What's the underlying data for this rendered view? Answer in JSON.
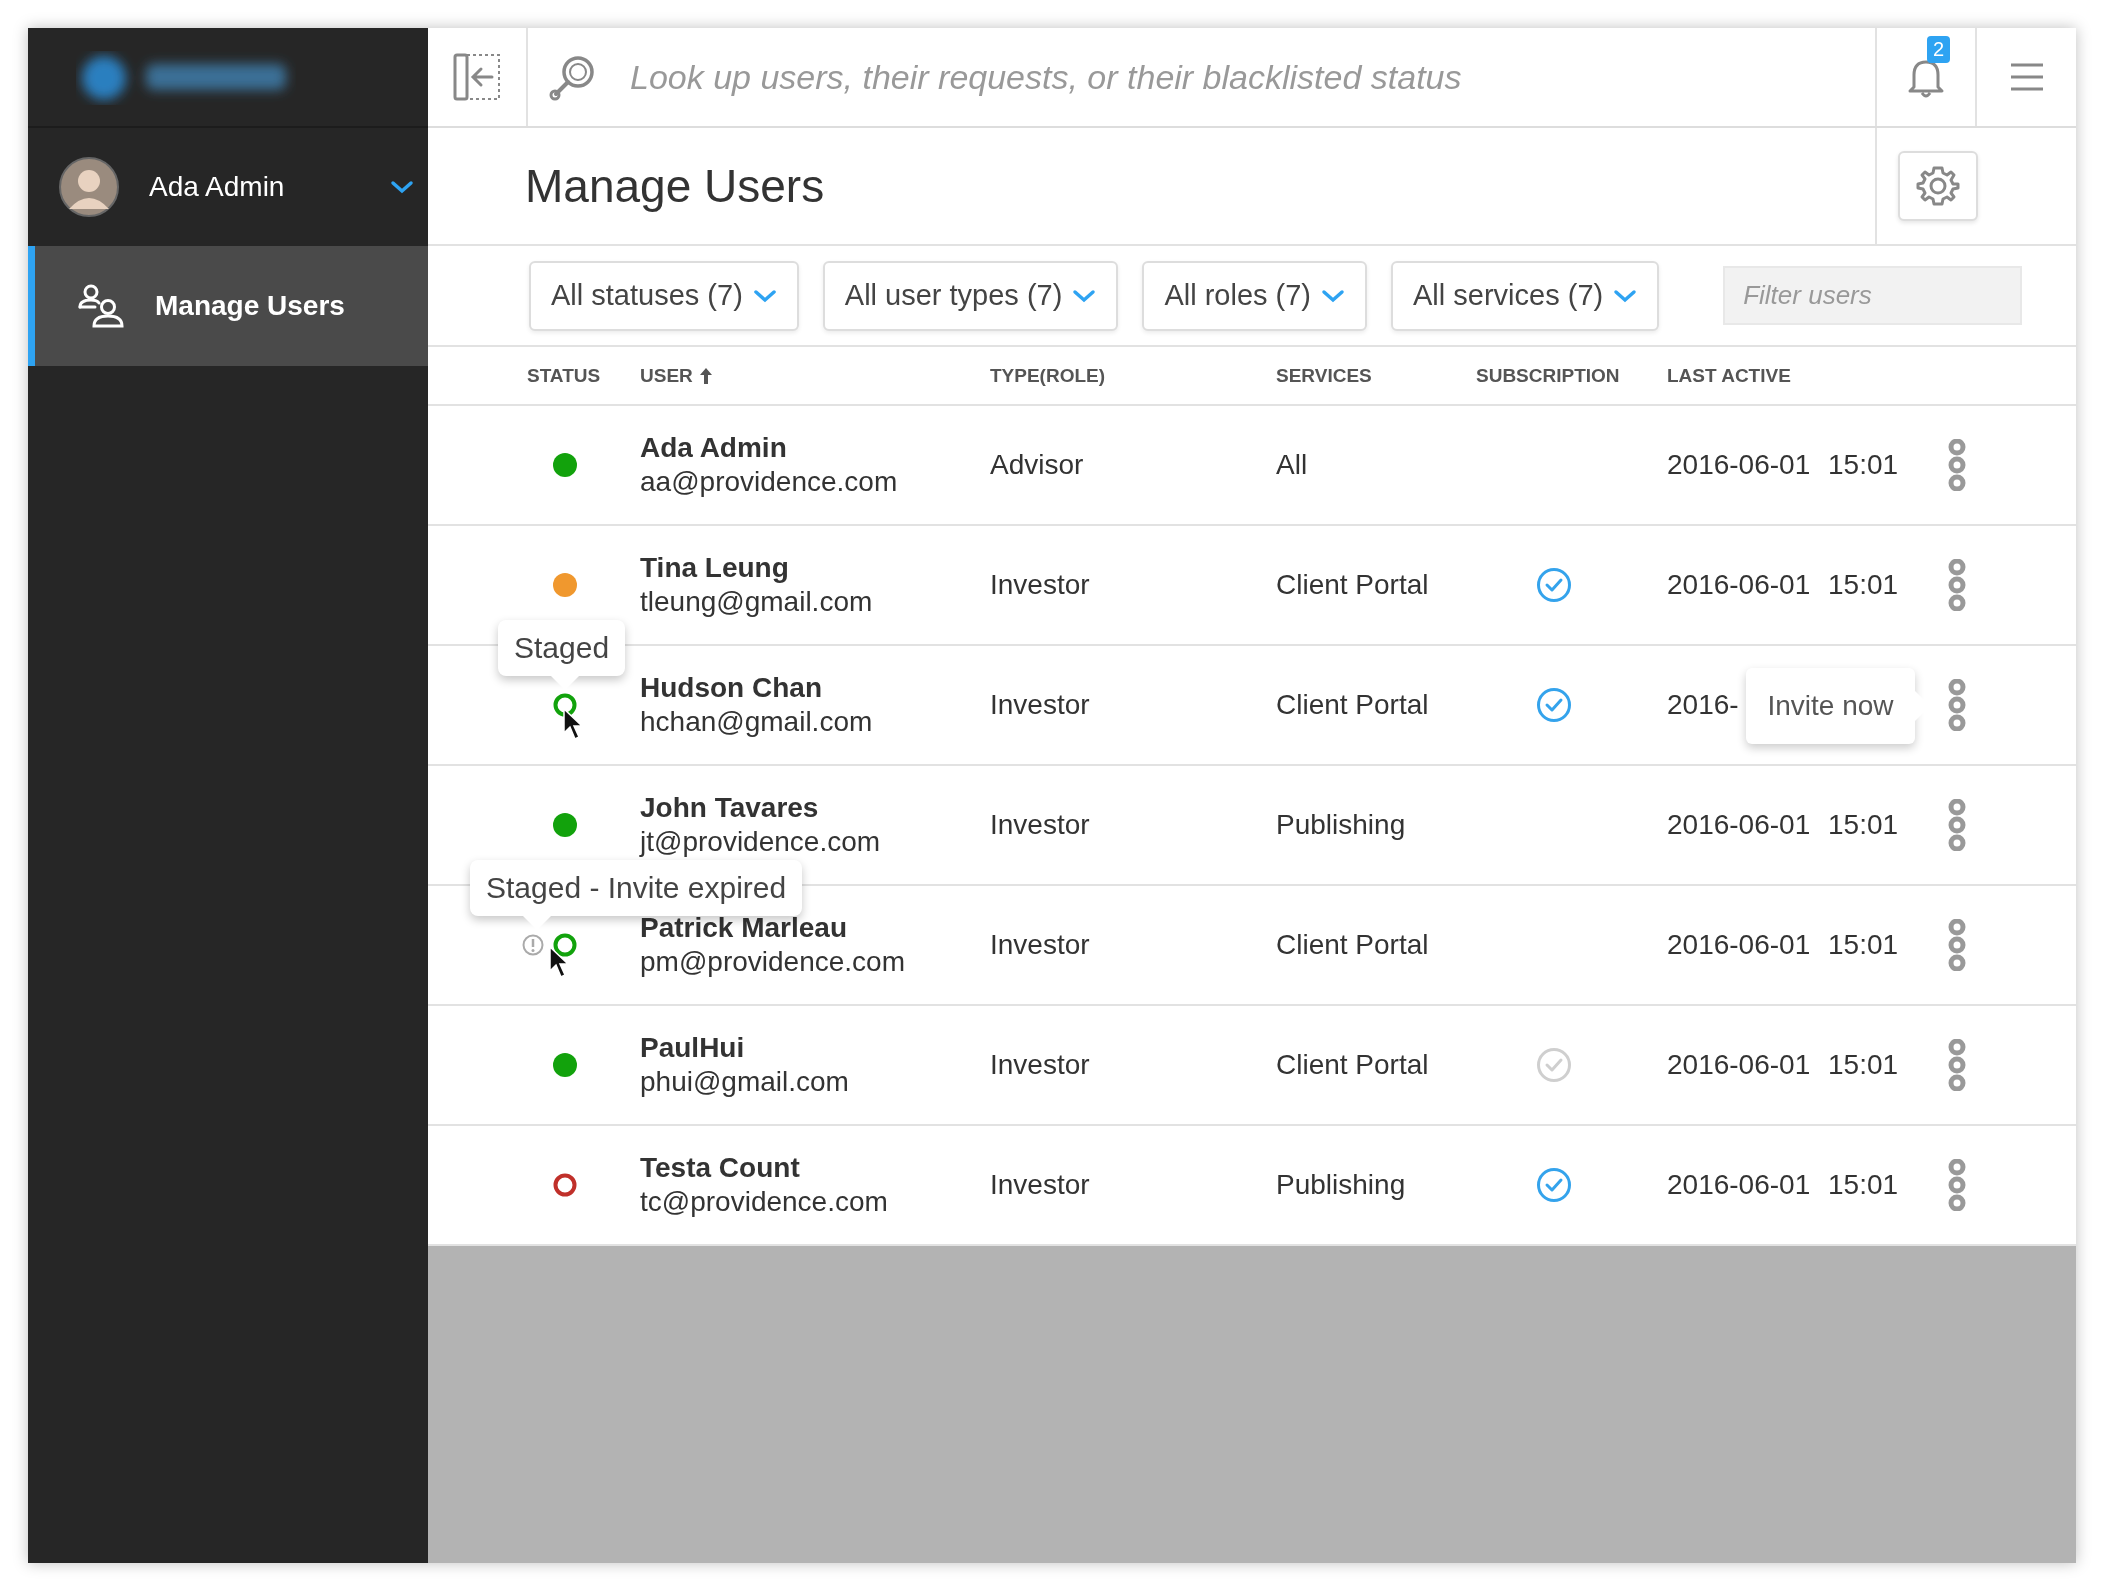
{
  "sidebar": {
    "user": {
      "name": "Ada Admin",
      "expanded": false
    },
    "items": [
      {
        "label": "Manage Users",
        "selected": true
      }
    ]
  },
  "search": {
    "placeholder": "Look up users, their requests, or their blacklisted status"
  },
  "notifications": {
    "count": "2"
  },
  "page": {
    "title": "Manage Users"
  },
  "filters": [
    {
      "label": "All statuses (7)"
    },
    {
      "label": "All user types (7)"
    },
    {
      "label": "All roles (7)"
    },
    {
      "label": "All services (7)"
    }
  ],
  "filter_input": {
    "placeholder": "Filter users"
  },
  "table": {
    "columns": [
      {
        "label": "STATUS",
        "sorted": false
      },
      {
        "label": "USER",
        "sorted": true
      },
      {
        "label": "TYPE(ROLE)",
        "sorted": false
      },
      {
        "label": "SERVICES",
        "sorted": false
      },
      {
        "label": "SUBSCRIPTION",
        "sorted": false
      },
      {
        "label": "LAST ACTIVE",
        "sorted": false
      }
    ],
    "rows": [
      {
        "status": {
          "kind": "filled",
          "color": "#12a20c"
        },
        "name": "Ada Admin",
        "email": "aa@providence.com",
        "role": "Advisor",
        "services": "All",
        "last_active": "2016-06-01 15:01"
      },
      {
        "status": {
          "kind": "filled",
          "color": "#f0982e"
        },
        "name": "Tina Leung",
        "email": "tleung@gmail.com",
        "role": "Investor",
        "services": "Client Portal",
        "subscription": {
          "active": true
        },
        "last_active": "2016-06-01 15:01"
      },
      {
        "status": {
          "kind": "ring",
          "color": "#12a20c",
          "tooltip": "Staged"
        },
        "name": "Hudson Chan",
        "email": "hchan@gmail.com",
        "role": "Investor",
        "services": "Client Portal",
        "subscription": {
          "active": true
        },
        "last_active": "2016-",
        "action_tooltip": "Invite now"
      },
      {
        "status": {
          "kind": "filled",
          "color": "#12a20c"
        },
        "name": "John Tavares",
        "email": "jt@providence.com",
        "role": "Investor",
        "services": "Publishing",
        "last_active": "2016-06-01 15:01"
      },
      {
        "status": {
          "kind": "ring",
          "color": "#12a20c",
          "warning": true,
          "tooltip": "Staged - Invite expired"
        },
        "name": "Patrick Marleau",
        "email": "pm@providence.com",
        "role": "Investor",
        "services": "Client Portal",
        "last_active": "2016-06-01 15:01"
      },
      {
        "status": {
          "kind": "filled",
          "color": "#12a20c"
        },
        "name": "PaulHui",
        "email": "phui@gmail.com",
        "role": "Investor",
        "services": "Client Portal",
        "subscription": {
          "active": false
        },
        "last_active": "2016-06-01 15:01"
      },
      {
        "status": {
          "kind": "ring",
          "color": "#c0302a"
        },
        "name": "Testa Count",
        "email": "tc@providence.com",
        "role": "Investor",
        "services": "Publishing",
        "subscription": {
          "active": true
        },
        "last_active": "2016-06-01 15:01"
      }
    ]
  }
}
